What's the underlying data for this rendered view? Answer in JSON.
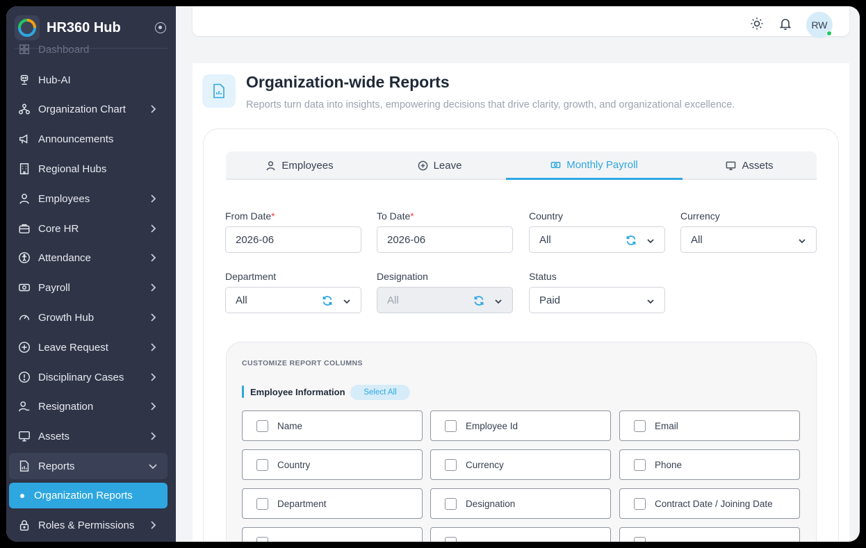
{
  "app": {
    "name": "HR360 Hub"
  },
  "sidebar": {
    "items": [
      {
        "label": "Dashboard",
        "icon": "dashboard-icon"
      },
      {
        "label": "Hub-AI",
        "icon": "robot-icon"
      },
      {
        "label": "Organization Chart",
        "icon": "org-chart-icon"
      },
      {
        "label": "Announcements",
        "icon": "megaphone-icon"
      },
      {
        "label": "Regional Hubs",
        "icon": "building-icon"
      },
      {
        "label": "Employees",
        "icon": "user-icon"
      },
      {
        "label": "Core HR",
        "icon": "briefcase-icon"
      },
      {
        "label": "Attendance",
        "icon": "attendance-icon"
      },
      {
        "label": "Payroll",
        "icon": "cash-icon"
      },
      {
        "label": "Growth Hub",
        "icon": "gauge-icon"
      },
      {
        "label": "Leave Request",
        "icon": "plus-circle-icon"
      },
      {
        "label": "Disciplinary Cases",
        "icon": "alert-circle-icon"
      },
      {
        "label": "Resignation",
        "icon": "user-minus-icon"
      },
      {
        "label": "Assets",
        "icon": "monitor-icon"
      },
      {
        "label": "Reports",
        "icon": "report-icon"
      },
      {
        "label": "Roles & Permissions",
        "icon": "lock-icon"
      }
    ],
    "sub_item": "Organization Reports"
  },
  "topbar": {
    "avatar_initials": "RW"
  },
  "page": {
    "title": "Organization-wide Reports",
    "subtitle": "Reports turn data into insights, empowering decisions that drive clarity, growth, and organizational excellence."
  },
  "tabs": [
    {
      "label": "Employees",
      "icon": "user-icon"
    },
    {
      "label": "Leave",
      "icon": "plus-circle-icon"
    },
    {
      "label": "Monthly Payroll",
      "icon": "cash-icon",
      "active": true
    },
    {
      "label": "Assets",
      "icon": "monitor-icon"
    }
  ],
  "filters": {
    "from_date": {
      "label": "From Date",
      "value": "2026-06",
      "required": "*"
    },
    "to_date": {
      "label": "To Date",
      "value": "2026-06",
      "required": "*"
    },
    "country": {
      "label": "Country",
      "value": "All"
    },
    "currency": {
      "label": "Currency",
      "value": "All"
    },
    "department": {
      "label": "Department",
      "value": "All"
    },
    "designation": {
      "label": "Designation",
      "value": "All"
    },
    "status": {
      "label": "Status",
      "value": "Paid"
    }
  },
  "columns": {
    "title": "CUSTOMIZE REPORT COLUMNS",
    "section": "Employee Information",
    "select_all": "Select All",
    "items": [
      "Name",
      "Employee Id",
      "Email",
      "Country",
      "Currency",
      "Phone",
      "Department",
      "Designation",
      "Contract Date / Joining Date"
    ]
  },
  "colors": {
    "accent": "#2ea7e0",
    "sidebar_bg": "#2f3447",
    "online": "#22c55e"
  }
}
